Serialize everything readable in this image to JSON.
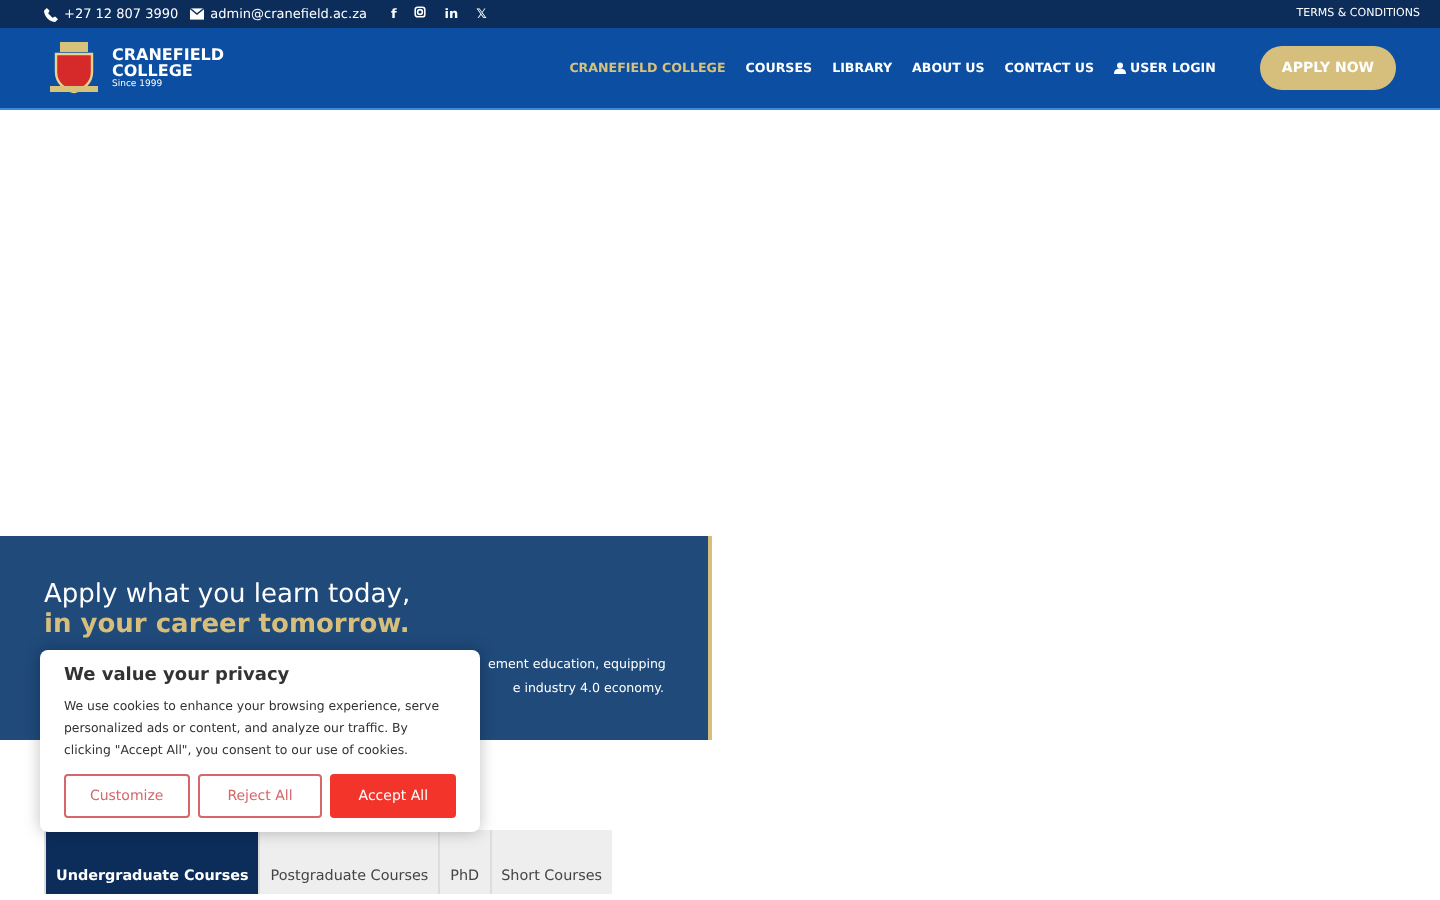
{
  "topbar": {
    "phone": "+27 12 807 3990",
    "email": "admin@cranefield.ac.za",
    "social": [
      "f",
      "in",
      "𝕏"
    ],
    "terms": "TERMS & CONDITIONS"
  },
  "header": {
    "logo": {
      "name_line1": "CRANEFIELD",
      "name_line2": "COLLEGE",
      "since": "Since 1999"
    },
    "nav": [
      {
        "label": "CRANEFIELD COLLEGE",
        "selected": true
      },
      {
        "label": "COURSES",
        "selected": false
      },
      {
        "label": "LIBRARY",
        "selected": false
      },
      {
        "label": "ABOUT US",
        "selected": false
      },
      {
        "label": "CONTACT US",
        "selected": false
      },
      {
        "label": "USER LOGIN",
        "selected": false
      }
    ],
    "cta": "APPLY NOW"
  },
  "hero": {
    "title": "Apply what you learn today,",
    "subtitle": "in your career tomorrow.",
    "text_lines": [
      "ement education, equipping",
      "e industry 4.0 economy."
    ]
  },
  "tabs": [
    {
      "label": "Undergraduate Courses",
      "selected": true
    },
    {
      "label": "Postgraduate Courses",
      "selected": false
    },
    {
      "label": "PhD",
      "selected": false
    },
    {
      "label": "Short Courses",
      "selected": false
    }
  ],
  "cookie": {
    "title": "We value your privacy",
    "text": "We use cookies to enhance your browsing experience, serve personalized ads or content, and analyze our traffic. By clicking \"Accept All\", you consent to our use of cookies.",
    "buttons": [
      {
        "label": "Customize",
        "kind": "outline"
      },
      {
        "label": "Reject All",
        "kind": "outline"
      },
      {
        "label": "Accept All",
        "kind": "filled"
      }
    ]
  }
}
